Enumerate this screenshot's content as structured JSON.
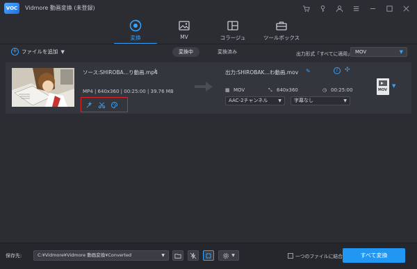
{
  "app": {
    "title": "Vidmore 動画変換 (未登録)",
    "logo_text": "VOC"
  },
  "window_icons": [
    "cart-icon",
    "key-icon",
    "user-icon",
    "menu-icon",
    "minimize-icon",
    "maximize-icon",
    "close-icon"
  ],
  "tabs": [
    {
      "label": "変換",
      "icon": "convert-icon",
      "active": true
    },
    {
      "label": "MV",
      "icon": "mv-image-icon",
      "active": false
    },
    {
      "label": "コラージュ",
      "icon": "collage-icon",
      "active": false
    },
    {
      "label": "ツールボックス",
      "icon": "toolbox-icon",
      "active": false
    }
  ],
  "toolbar": {
    "add_file": "ファイルを追加",
    "converting": "変換中",
    "converted": "変換済み",
    "output_format_label": "出力形式「すべてに適用」:",
    "output_format_value": "MOV"
  },
  "file": {
    "source_name": "ソース:SHIROBA…り動画.mp4",
    "source_format": "MP4",
    "source_resolution": "640x360",
    "source_duration": "00:25:00",
    "source_size": "39.76 MB",
    "source_meta_sep": "|",
    "output_name": "出力:SHIROBAK…わ動画.mov",
    "output_format": "MOV",
    "output_resolution": "640x360",
    "output_duration": "00:25:00",
    "audio_track": "AAC-2チャンネル",
    "subtitle": "字幕なし",
    "format_badge": "MOV"
  },
  "bottom": {
    "save_label": "保存先:",
    "save_path": "C:¥Vidmore¥Vidmore 動画変換¥Converted",
    "merge_label": "一つのファイルに結合",
    "convert_all": "すべて変換"
  },
  "colors": {
    "accent": "#35a4ff",
    "convert_button": "#2196f3",
    "highlight_box": "#e0252a",
    "background": "#2b2d33",
    "row": "#34363d"
  }
}
